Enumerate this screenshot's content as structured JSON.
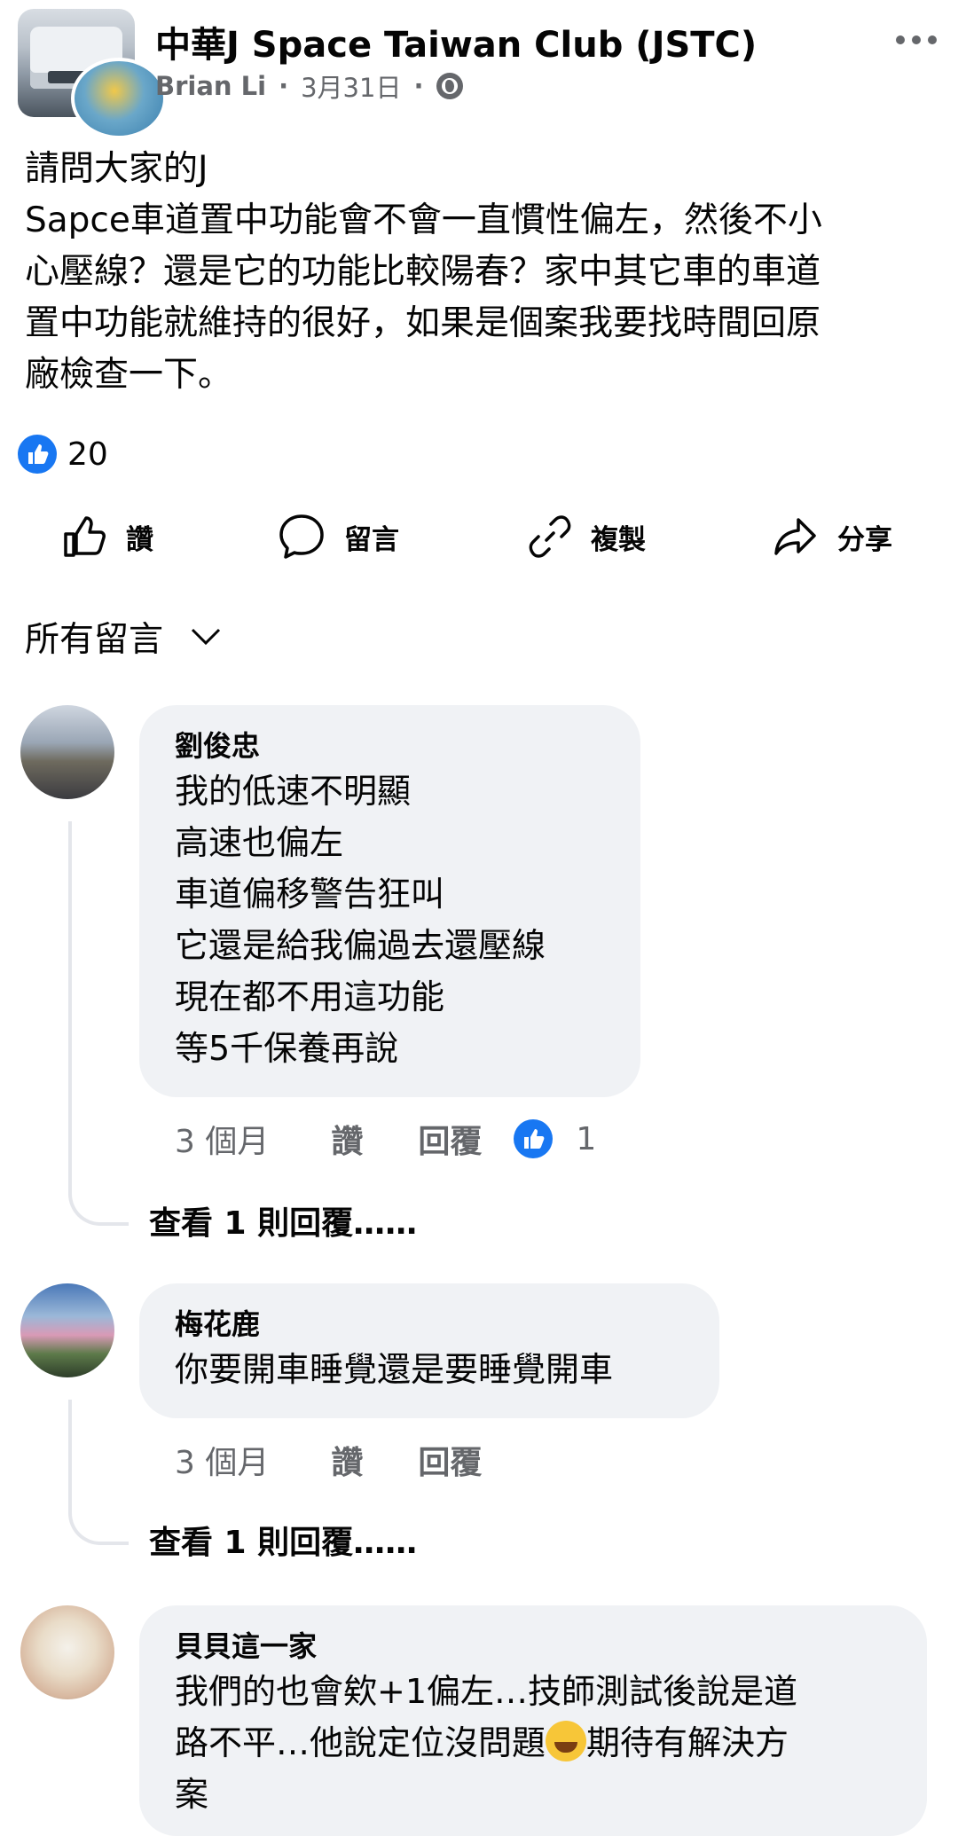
{
  "header": {
    "group_name": "中華J Space Taiwan Club (JSTC)",
    "author": "Brian Li",
    "separator": "·",
    "date": "3月31日",
    "privacy_icon": "globe-icon",
    "more_icon": "more-dots-icon"
  },
  "post": {
    "text": "請問大家的J\nSapce車道置中功能會不會一直慣性偏左，然後不小\n心壓線？還是它的功能比較陽春？家中其它車的車道\n置中功能就維持的很好，如果是個案我要找時間回原\n廠檢查一下。",
    "reaction_count": "20"
  },
  "actions": {
    "like": "讚",
    "comment": "留言",
    "copy": "複製",
    "share": "分享"
  },
  "sort": {
    "label": "所有留言"
  },
  "comments": [
    {
      "name": "劉俊忠",
      "text": "我的低速不明顯\n高速也偏左\n車道偏移警告狂叫\n它還是給我偏過去還壓線\n現在都不用這功能\n等5千保養再說",
      "time": "3 個月",
      "like": "讚",
      "reply": "回覆",
      "likes": "1",
      "view_replies": "查看 1 則回覆……"
    },
    {
      "name": "梅花鹿",
      "text": "你要開車睡覺還是要睡覺開車",
      "time": "3 個月",
      "like": "讚",
      "reply": "回覆",
      "view_replies": "查看 1 則回覆……"
    },
    {
      "name": "貝貝這一家",
      "text_before_emoji": "我們的也會欸+1偏左…技師測試後說是道\n路不平…他說定位沒問題",
      "emoji": "grinning-sweat-emoji",
      "text_after_emoji": "期待有解決方\n案"
    }
  ],
  "colors": {
    "accent": "#1877f2",
    "secondary_text": "#65676b",
    "bubble": "#f0f2f5"
  }
}
